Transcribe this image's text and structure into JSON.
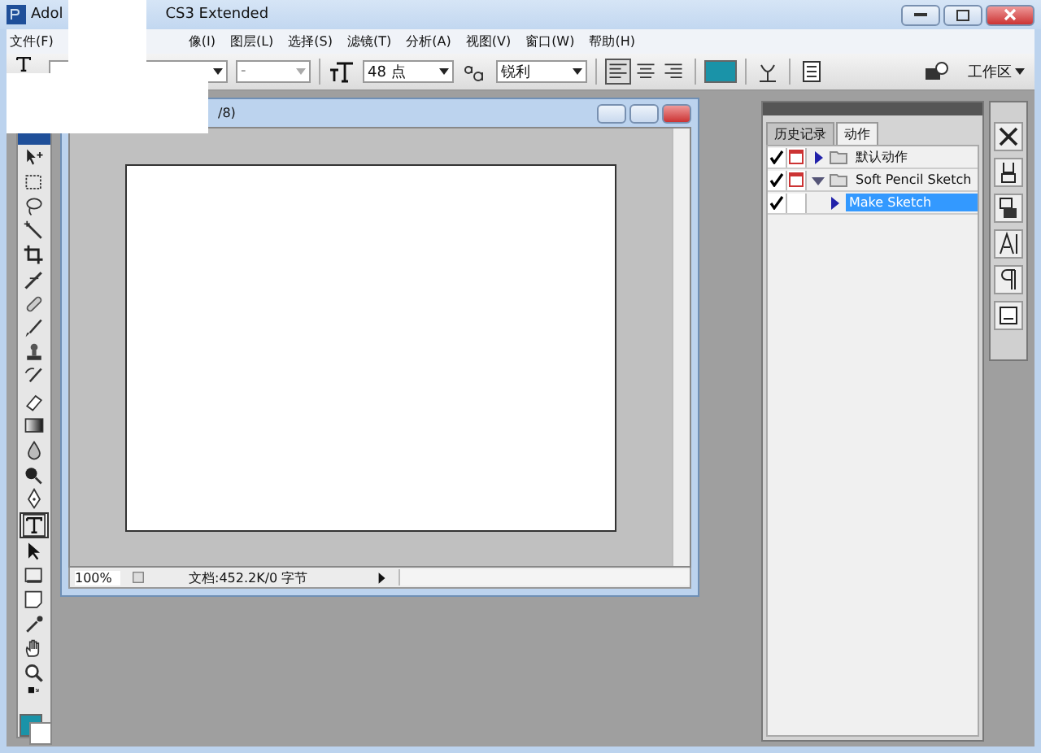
{
  "window": {
    "title_start": "Adol",
    "title_end": "CS3 Extended"
  },
  "menu": [
    "文件(F)",
    "像(I)",
    "图层(L)",
    "选择(S)",
    "滤镜(T)",
    "分析(A)",
    "视图(V)",
    "窗口(W)",
    "帮助(H)"
  ],
  "options_bar": {
    "style_value": "-",
    "size_value": "48 点",
    "antialias_value": "锐利",
    "alignment": [
      {
        "kind": "left",
        "selected": true
      },
      {
        "kind": "center",
        "selected": false
      },
      {
        "kind": "right",
        "selected": false
      }
    ],
    "workspace_label": "工作区"
  },
  "tools": [
    {
      "kind": "move",
      "selected": false
    },
    {
      "kind": "marquee",
      "selected": false
    },
    {
      "kind": "lasso",
      "selected": false
    },
    {
      "kind": "wand",
      "selected": false
    },
    {
      "kind": "crop",
      "selected": false
    },
    {
      "kind": "slice",
      "selected": false
    },
    {
      "kind": "heal",
      "selected": false
    },
    {
      "kind": "brush",
      "selected": false
    },
    {
      "kind": "stamp",
      "selected": false
    },
    {
      "kind": "history",
      "selected": false
    },
    {
      "kind": "eraser",
      "selected": false
    },
    {
      "kind": "gradient",
      "selected": false
    },
    {
      "kind": "blur",
      "selected": false
    },
    {
      "kind": "dodge",
      "selected": false
    },
    {
      "kind": "pen",
      "selected": false
    },
    {
      "kind": "type",
      "selected": true
    },
    {
      "kind": "select",
      "selected": false
    },
    {
      "kind": "shape",
      "selected": false
    },
    {
      "kind": "notes",
      "selected": false
    },
    {
      "kind": "eyedropper",
      "selected": false
    },
    {
      "kind": "hand",
      "selected": false
    },
    {
      "kind": "zoom",
      "selected": false
    }
  ],
  "document": {
    "title": "/8)",
    "zoom": "100%",
    "status": "文档:452.2K/0 字节"
  },
  "panel": {
    "tabs": [
      {
        "label": "历史记录",
        "selected": false
      },
      {
        "label": "动作",
        "selected": true
      }
    ],
    "actions": [
      {
        "kind": "set",
        "label": "默认动作",
        "checked": true,
        "dialog": true,
        "expanded": false,
        "selected": false
      },
      {
        "kind": "set",
        "label": "Soft Pencil Sketch",
        "checked": true,
        "dialog": true,
        "expanded": true,
        "selected": false,
        "children": [
          {
            "kind": "action",
            "label": "Make Sketch",
            "checked": true,
            "dialog": false,
            "expanded": false,
            "selected": true
          }
        ]
      }
    ]
  }
}
